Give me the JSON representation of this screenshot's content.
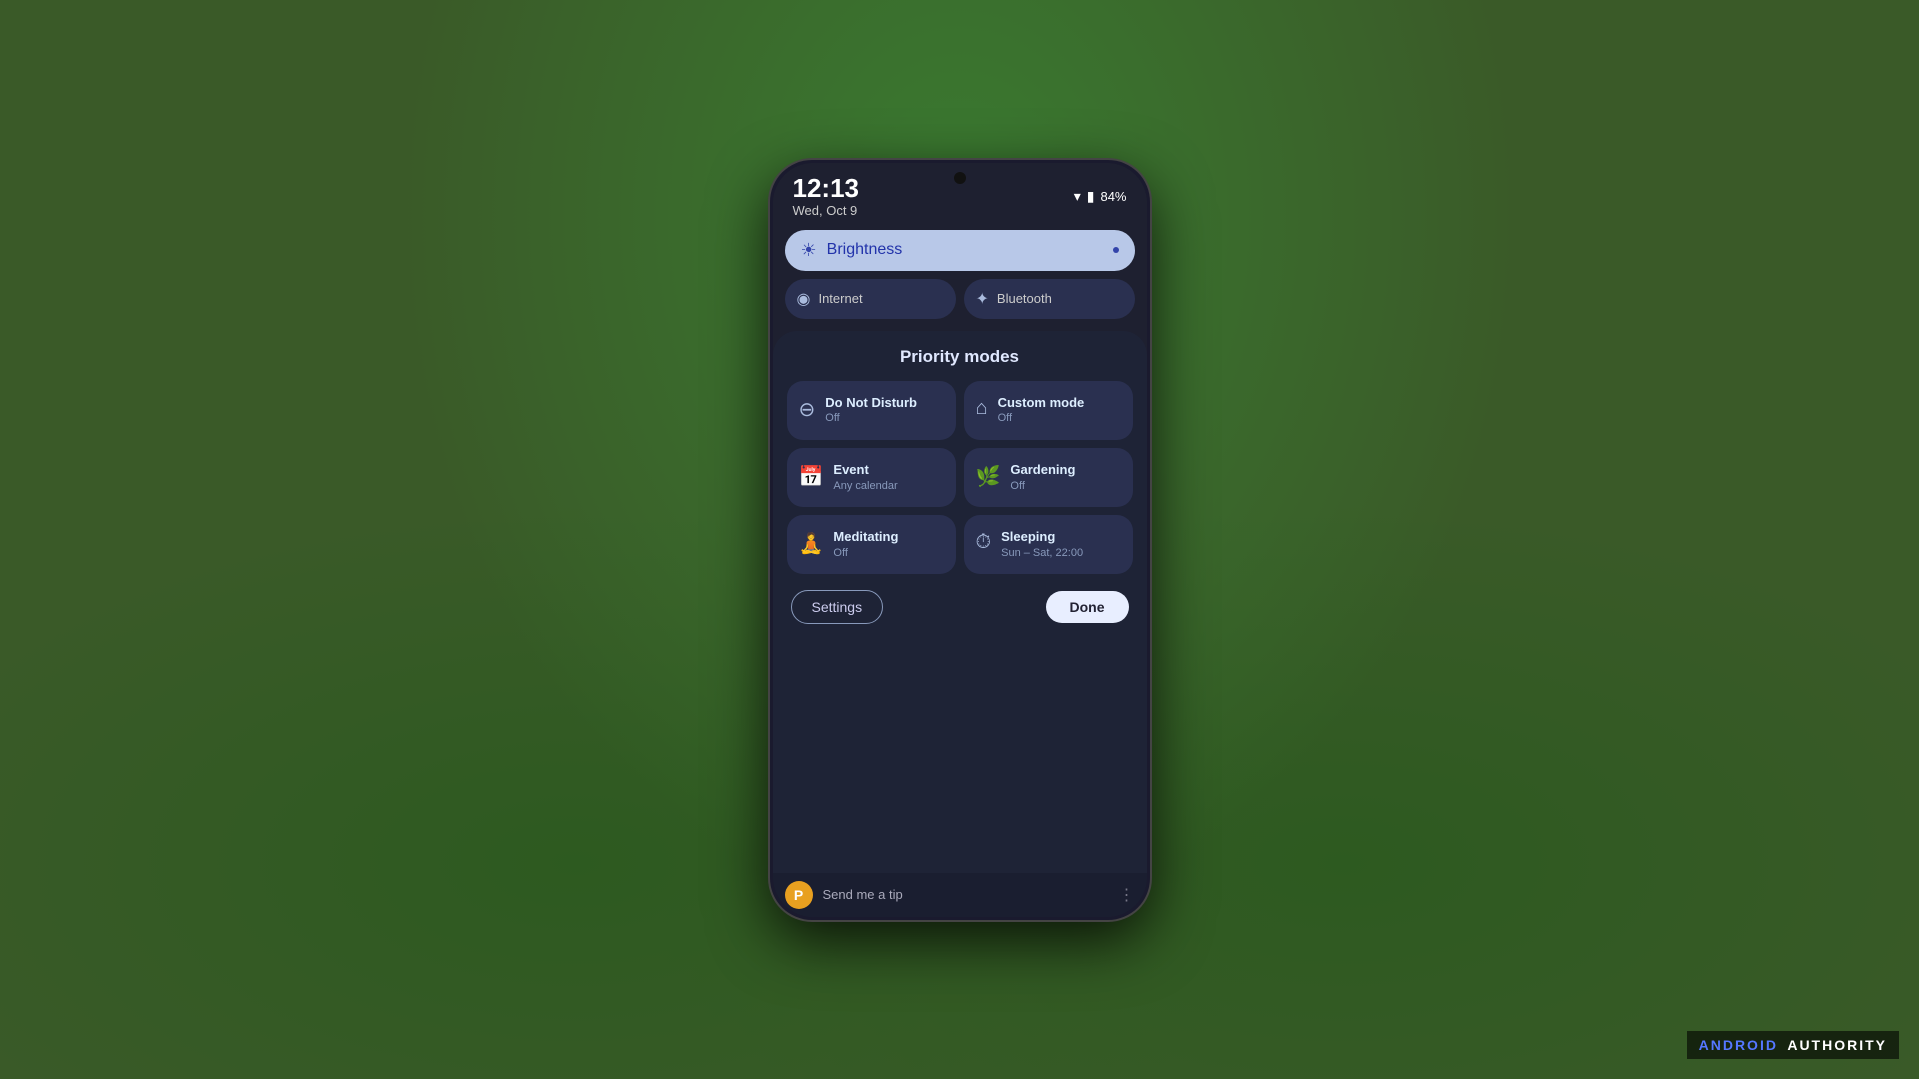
{
  "background": {
    "color": "#4a6a30"
  },
  "phone": {
    "status_bar": {
      "time": "12:13",
      "date": "Wed, Oct 9",
      "battery_pct": "84%",
      "wifi_symbol": "▾",
      "battery_symbol": "🔋"
    },
    "quick_settings": {
      "brightness": {
        "label": "Brightness",
        "icon": "☀",
        "dot": "•"
      },
      "internet": {
        "label": "Internet",
        "icon": "◉"
      },
      "bluetooth": {
        "label": "Bluetooth",
        "icon": "✦"
      }
    },
    "priority_modes": {
      "title": "Priority modes",
      "modes": [
        {
          "name": "Do Not Disturb",
          "status": "Off",
          "icon": "⊖"
        },
        {
          "name": "Custom mode",
          "status": "Off",
          "icon": "⌂"
        },
        {
          "name": "Event",
          "status": "Any calendar",
          "icon": "📅"
        },
        {
          "name": "Gardening",
          "status": "Off",
          "icon": "🌿"
        },
        {
          "name": "Meditating",
          "status": "Off",
          "icon": "🧘"
        },
        {
          "name": "Sleeping",
          "status": "Sun – Sat, 22:00",
          "icon": "⏱"
        }
      ],
      "settings_button": "Settings",
      "done_button": "Done"
    },
    "tip_bar": {
      "icon": "P",
      "text": "Send me a tip",
      "more": "⋮"
    }
  },
  "watermark": {
    "brand": "ANDROID",
    "suffix": "AUTHORITY"
  }
}
